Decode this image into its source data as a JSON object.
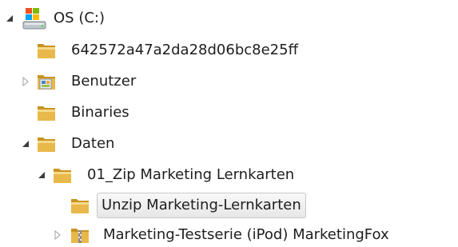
{
  "tree": {
    "items": [
      {
        "label": "OS (C:)",
        "icon": "drive-icon",
        "arrow": "expanded"
      },
      {
        "label": "642572a47a2da28d06bc8e25ff",
        "icon": "folder-icon",
        "arrow": "none"
      },
      {
        "label": "Benutzer",
        "icon": "users-folder-icon",
        "arrow": "collapsed"
      },
      {
        "label": "Binaries",
        "icon": "folder-icon",
        "arrow": "none"
      },
      {
        "label": "Daten",
        "icon": "folder-icon",
        "arrow": "expanded"
      },
      {
        "label": "01_Zip Marketing Lernkarten",
        "icon": "folder-icon",
        "arrow": "expanded"
      },
      {
        "label": "Unzip Marketing-Lernkarten",
        "icon": "folder-icon",
        "arrow": "none",
        "selected": true
      },
      {
        "label": "Marketing-Testserie (iPod) MarketingFox",
        "icon": "zip-folder-icon",
        "arrow": "collapsed"
      }
    ]
  },
  "colors": {
    "folder": "#e8b84a",
    "folder_dark": "#c99420",
    "arrow_expanded": "#3c3c3c",
    "arrow_collapsed": "#a0a0a0",
    "selection_border": "#c8c8c8"
  }
}
